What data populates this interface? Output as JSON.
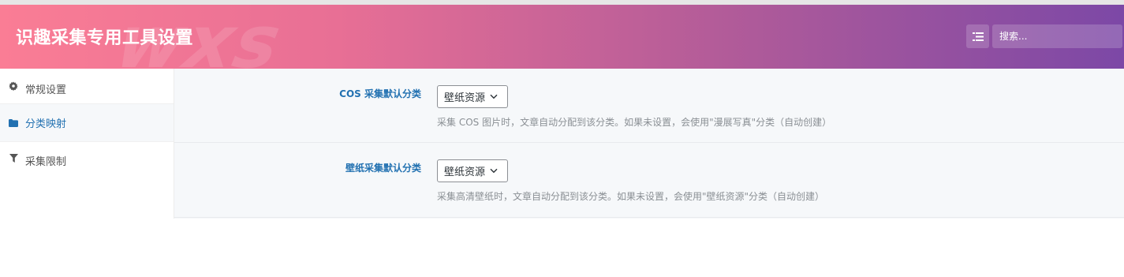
{
  "header": {
    "title": "识趣采集专用工具设置",
    "watermark": "wxs",
    "search_placeholder": "搜索..."
  },
  "sidebar": {
    "items": [
      {
        "label": "常规设置",
        "icon": "gear-icon"
      },
      {
        "label": "分类映射",
        "icon": "folder-icon"
      },
      {
        "label": "采集限制",
        "icon": "filter-icon"
      }
    ],
    "active_index": 1
  },
  "settings": [
    {
      "label": "COS 采集默认分类",
      "selected": "壁纸资源",
      "description": "采集 COS 图片时，文章自动分配到该分类。如果未设置，会使用\"漫展写真\"分类（自动创建）"
    },
    {
      "label": "壁纸采集默认分类",
      "selected": "壁纸资源",
      "description": "采集高清壁纸时，文章自动分配到该分类。如果未设置，会使用\"壁纸资源\"分类（自动创建）"
    }
  ],
  "colors": {
    "accent": "#2271b1",
    "header_gradient_start": "#fa7d95",
    "header_gradient_end": "#7c48a6"
  }
}
